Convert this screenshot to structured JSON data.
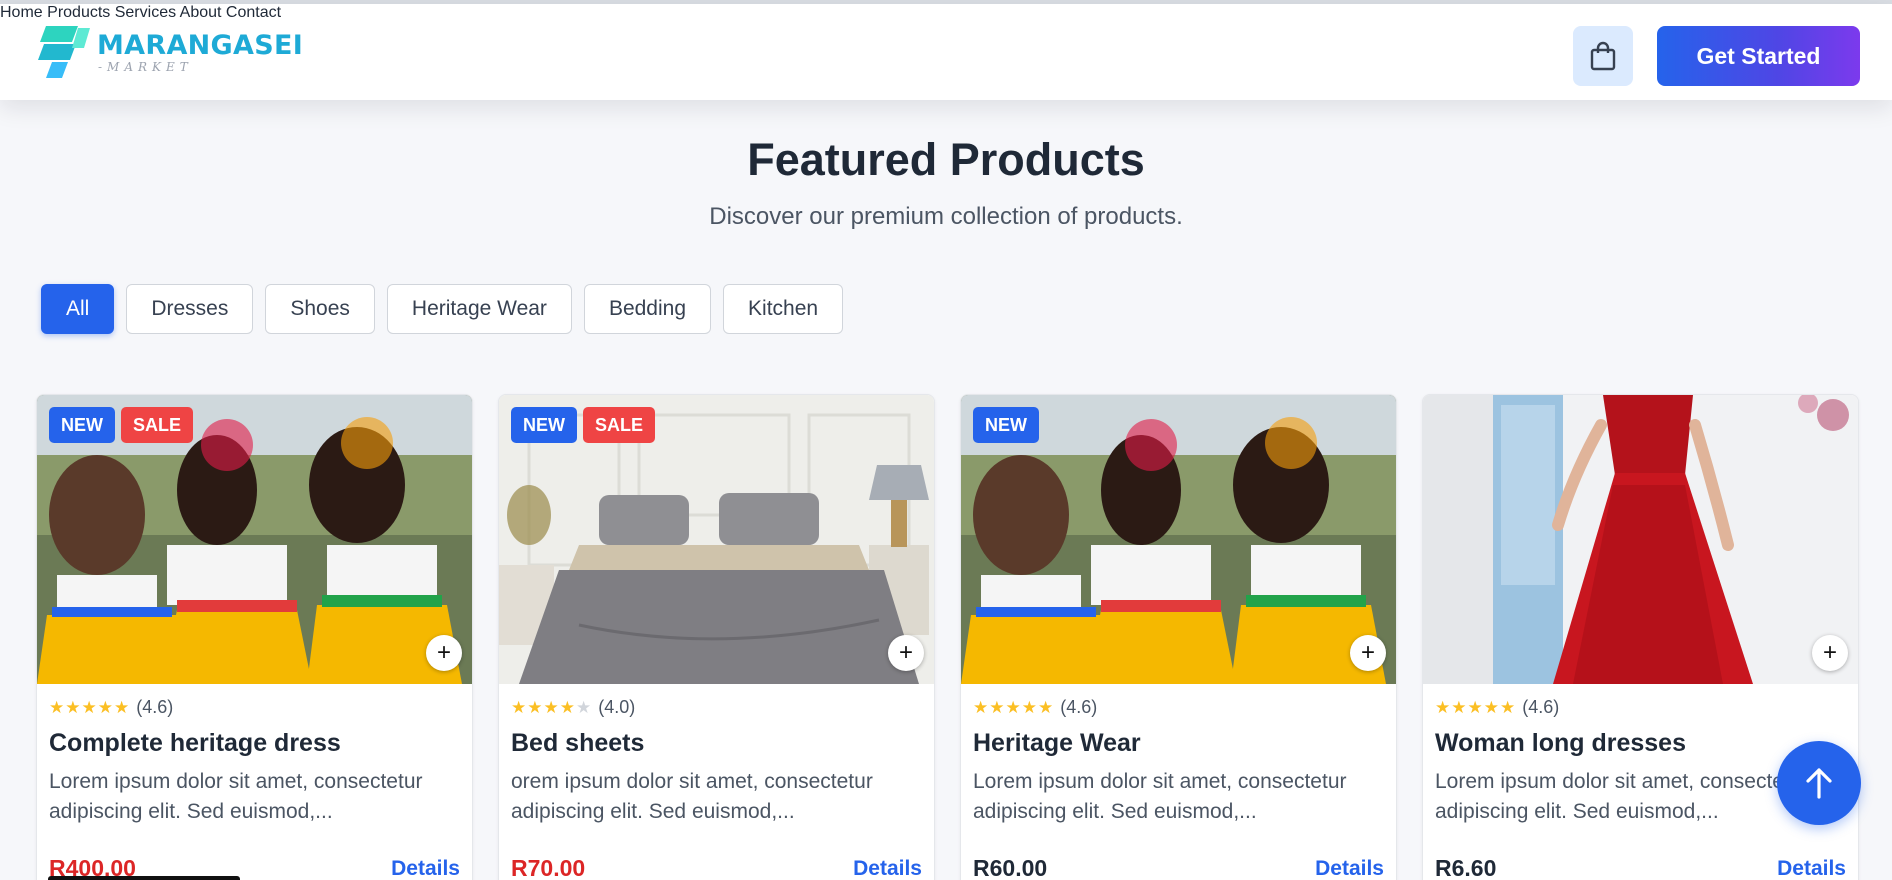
{
  "brand": {
    "name": "MARANGASEI",
    "sub": "-MARKET"
  },
  "nav": {
    "items": [
      {
        "label": "Home"
      },
      {
        "label": "Products"
      },
      {
        "label": "Services"
      },
      {
        "label": "About"
      },
      {
        "label": "Contact"
      }
    ],
    "cta_label": "Get Started"
  },
  "hero": {
    "title": "Featured Products",
    "subtitle": "Discover our premium collection of products."
  },
  "filters": [
    "All",
    "Dresses",
    "Shoes",
    "Heritage Wear",
    "Bedding",
    "Kitchen"
  ],
  "active_filter": "All",
  "products": [
    {
      "badges": [
        "NEW",
        "SALE"
      ],
      "stars": "★★★★★",
      "rating": "(4.6)",
      "name": "Complete heritage dress",
      "desc1": "Lorem ipsum dolor sit amet, consectetur",
      "desc2": "adipiscing elit. Sed euismod,...",
      "price": "R400.00",
      "price_on_sale": true,
      "details": "Details"
    },
    {
      "badges": [
        "NEW",
        "SALE"
      ],
      "stars": "★★★★★",
      "rating": "(4.0)",
      "name": "Bed sheets",
      "desc1": "orem ipsum dolor sit amet, consectetur",
      "desc2": "adipiscing elit. Sed euismod,...",
      "price": "R70.00",
      "price_on_sale": true,
      "details": "Details"
    },
    {
      "badges": [
        "NEW"
      ],
      "stars": "★★★★★",
      "rating": "(4.6)",
      "name": "Heritage Wear",
      "desc1": "Lorem ipsum dolor sit amet, consectetur",
      "desc2": "adipiscing elit. Sed euismod,...",
      "price": "R60.00",
      "price_on_sale": false,
      "details": "Details"
    },
    {
      "badges": [],
      "stars": "★★★★★",
      "rating": "(4.6)",
      "name": "Woman long dresses",
      "desc1": "Lorem ipsum dolor sit amet, consectetur",
      "desc2": "adipiscing elit. Sed euismod,...",
      "price": "R6.60",
      "price_on_sale": false,
      "details": "Details"
    }
  ],
  "colors": {
    "accent": "#2563eb",
    "sale": "#ef4444",
    "logo": "#1eaad6",
    "star": "#fbbf24"
  },
  "icons": {
    "cart": "shopping-bag-icon",
    "add": "plus-icon",
    "scroll": "arrow-up-icon"
  }
}
